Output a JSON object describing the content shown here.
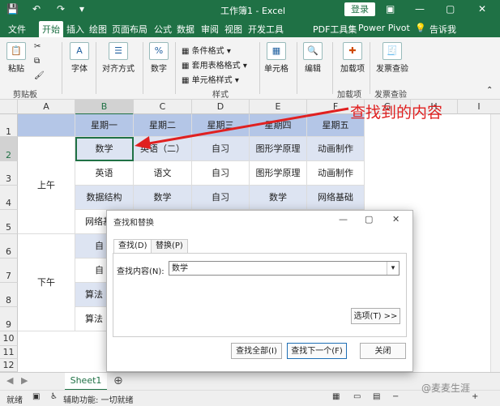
{
  "window": {
    "title": "工作簿1 - Excel",
    "login_label": "登录"
  },
  "menu": {
    "items": [
      "文件",
      "开始",
      "插入",
      "绘图",
      "页面布局",
      "公式",
      "数据",
      "审阅",
      "视图",
      "开发工具",
      "PDF工具集",
      "Power Pivot"
    ],
    "active": "开始",
    "tell_me": "告诉我"
  },
  "ribbon": {
    "paste": "粘贴",
    "clipboard": "剪贴板",
    "font": "字体",
    "alignment": "对齐方式",
    "number": "数字",
    "cond_format": "条件格式",
    "table_format": "套用表格格式",
    "cell_style": "单元格样式",
    "styles": "样式",
    "cells": "单元格",
    "editing": "编辑",
    "addin": "加载项",
    "addin_group": "加载项",
    "invoice_check": "发票查验",
    "invoice_group": "发票查验",
    "pct_symbol": "%",
    "font_icon": "A"
  },
  "sheet": {
    "columns": [
      "A",
      "B",
      "C",
      "D",
      "E",
      "F",
      "G",
      "H",
      "I"
    ],
    "rows": [
      "1",
      "2",
      "3",
      "4",
      "5",
      "6",
      "7",
      "8",
      "9",
      "10",
      "11",
      "12"
    ],
    "header_row": [
      "星期一",
      "星期二",
      "星期三",
      "星期四",
      "星期五"
    ],
    "row2": [
      "数学",
      "英语（二）",
      "自习",
      "图形学原理",
      "动画制作"
    ],
    "row3": [
      "英语",
      "语文",
      "自习",
      "图形学原理",
      "动画制作"
    ],
    "row4": [
      "数据结构",
      "数学",
      "自习",
      "数学",
      "网络基础"
    ],
    "row5_b": "网络基",
    "row6_b": "自",
    "row7_b": "自",
    "row8_b": "算法",
    "row9_b": "算法",
    "morning": "上午",
    "afternoon": "下午",
    "sheet_tab": "Sheet1"
  },
  "status": {
    "ready": "就绪",
    "accessibility": "辅助功能: 一切就绪"
  },
  "annotation": {
    "text": "查找到的内容",
    "color": "#e02020"
  },
  "watermark": "@麦麦生涯",
  "dialog": {
    "title": "查找和替换",
    "tab_find": "查找(D)",
    "tab_replace": "替换(P)",
    "find_label": "查找内容(N):",
    "find_value": "数学",
    "options_button": "选项(T) >>",
    "find_all": "查找全部(I)",
    "find_next": "查找下一个(F)",
    "close": "关闭"
  },
  "colors": {
    "excel_green": "#1f7145",
    "header_blue": "#b4c6e7",
    "band_blue": "#dde4f2"
  }
}
